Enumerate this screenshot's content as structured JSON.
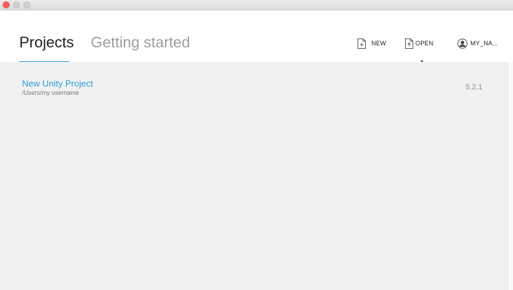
{
  "window": {
    "controls": [
      "close",
      "minimize",
      "maximize"
    ]
  },
  "tabs": [
    {
      "label": "Projects",
      "active": true
    },
    {
      "label": "Getting started",
      "active": false
    }
  ],
  "toolbar": {
    "new_label": "NEW",
    "new_icon": "new-file-icon",
    "open_label": "OPEN",
    "open_icon": "open-file-icon",
    "account_label": "MY_NA...",
    "account_icon": "user-avatar-icon"
  },
  "projects": [
    {
      "name": "New Unity Project",
      "path": "/Users/my username",
      "version": "5.2.1"
    }
  ],
  "colors": {
    "accent": "#2a9ed8",
    "content_bg": "#f1f1f1",
    "close_button": "#fc605b"
  }
}
